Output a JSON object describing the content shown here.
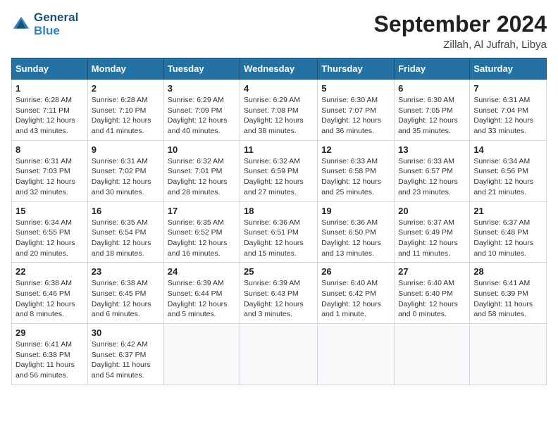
{
  "header": {
    "logo_line1": "General",
    "logo_line2": "Blue",
    "month_title": "September 2024",
    "location": "Zillah, Al Jufrah, Libya"
  },
  "days_of_week": [
    "Sunday",
    "Monday",
    "Tuesday",
    "Wednesday",
    "Thursday",
    "Friday",
    "Saturday"
  ],
  "weeks": [
    [
      {
        "day": "1",
        "sunrise": "6:28 AM",
        "sunset": "7:11 PM",
        "daylight": "12 hours and 43 minutes."
      },
      {
        "day": "2",
        "sunrise": "6:28 AM",
        "sunset": "7:10 PM",
        "daylight": "12 hours and 41 minutes."
      },
      {
        "day": "3",
        "sunrise": "6:29 AM",
        "sunset": "7:09 PM",
        "daylight": "12 hours and 40 minutes."
      },
      {
        "day": "4",
        "sunrise": "6:29 AM",
        "sunset": "7:08 PM",
        "daylight": "12 hours and 38 minutes."
      },
      {
        "day": "5",
        "sunrise": "6:30 AM",
        "sunset": "7:07 PM",
        "daylight": "12 hours and 36 minutes."
      },
      {
        "day": "6",
        "sunrise": "6:30 AM",
        "sunset": "7:05 PM",
        "daylight": "12 hours and 35 minutes."
      },
      {
        "day": "7",
        "sunrise": "6:31 AM",
        "sunset": "7:04 PM",
        "daylight": "12 hours and 33 minutes."
      }
    ],
    [
      {
        "day": "8",
        "sunrise": "6:31 AM",
        "sunset": "7:03 PM",
        "daylight": "12 hours and 32 minutes."
      },
      {
        "day": "9",
        "sunrise": "6:31 AM",
        "sunset": "7:02 PM",
        "daylight": "12 hours and 30 minutes."
      },
      {
        "day": "10",
        "sunrise": "6:32 AM",
        "sunset": "7:01 PM",
        "daylight": "12 hours and 28 minutes."
      },
      {
        "day": "11",
        "sunrise": "6:32 AM",
        "sunset": "6:59 PM",
        "daylight": "12 hours and 27 minutes."
      },
      {
        "day": "12",
        "sunrise": "6:33 AM",
        "sunset": "6:58 PM",
        "daylight": "12 hours and 25 minutes."
      },
      {
        "day": "13",
        "sunrise": "6:33 AM",
        "sunset": "6:57 PM",
        "daylight": "12 hours and 23 minutes."
      },
      {
        "day": "14",
        "sunrise": "6:34 AM",
        "sunset": "6:56 PM",
        "daylight": "12 hours and 21 minutes."
      }
    ],
    [
      {
        "day": "15",
        "sunrise": "6:34 AM",
        "sunset": "6:55 PM",
        "daylight": "12 hours and 20 minutes."
      },
      {
        "day": "16",
        "sunrise": "6:35 AM",
        "sunset": "6:54 PM",
        "daylight": "12 hours and 18 minutes."
      },
      {
        "day": "17",
        "sunrise": "6:35 AM",
        "sunset": "6:52 PM",
        "daylight": "12 hours and 16 minutes."
      },
      {
        "day": "18",
        "sunrise": "6:36 AM",
        "sunset": "6:51 PM",
        "daylight": "12 hours and 15 minutes."
      },
      {
        "day": "19",
        "sunrise": "6:36 AM",
        "sunset": "6:50 PM",
        "daylight": "12 hours and 13 minutes."
      },
      {
        "day": "20",
        "sunrise": "6:37 AM",
        "sunset": "6:49 PM",
        "daylight": "12 hours and 11 minutes."
      },
      {
        "day": "21",
        "sunrise": "6:37 AM",
        "sunset": "6:48 PM",
        "daylight": "12 hours and 10 minutes."
      }
    ],
    [
      {
        "day": "22",
        "sunrise": "6:38 AM",
        "sunset": "6:46 PM",
        "daylight": "12 hours and 8 minutes."
      },
      {
        "day": "23",
        "sunrise": "6:38 AM",
        "sunset": "6:45 PM",
        "daylight": "12 hours and 6 minutes."
      },
      {
        "day": "24",
        "sunrise": "6:39 AM",
        "sunset": "6:44 PM",
        "daylight": "12 hours and 5 minutes."
      },
      {
        "day": "25",
        "sunrise": "6:39 AM",
        "sunset": "6:43 PM",
        "daylight": "12 hours and 3 minutes."
      },
      {
        "day": "26",
        "sunrise": "6:40 AM",
        "sunset": "6:42 PM",
        "daylight": "12 hours and 1 minute."
      },
      {
        "day": "27",
        "sunrise": "6:40 AM",
        "sunset": "6:40 PM",
        "daylight": "12 hours and 0 minutes."
      },
      {
        "day": "28",
        "sunrise": "6:41 AM",
        "sunset": "6:39 PM",
        "daylight": "11 hours and 58 minutes."
      }
    ],
    [
      {
        "day": "29",
        "sunrise": "6:41 AM",
        "sunset": "6:38 PM",
        "daylight": "11 hours and 56 minutes."
      },
      {
        "day": "30",
        "sunrise": "6:42 AM",
        "sunset": "6:37 PM",
        "daylight": "11 hours and 54 minutes."
      },
      null,
      null,
      null,
      null,
      null
    ]
  ]
}
